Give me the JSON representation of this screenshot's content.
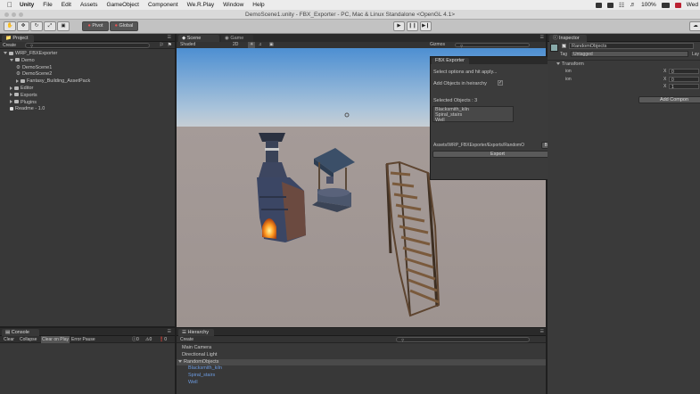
{
  "menubar": {
    "app": "Unity",
    "items": [
      "File",
      "Edit",
      "Assets",
      "GameObject",
      "Component",
      "We.R.Play",
      "Window",
      "Help"
    ],
    "battery": "100%",
    "clock": "Wed"
  },
  "window": {
    "title": "DemoScene1.unity - FBX_Exporter - PC, Mac & Linux Standalone <OpenGL 4.1>"
  },
  "toolbar": {
    "pivot_label": "Pivot",
    "global_label": "Global"
  },
  "project": {
    "tab": "Project",
    "create_label": "Create",
    "tree": [
      {
        "label": "WRP_FBXExporter",
        "depth": 0,
        "kind": "folder",
        "expanded": true
      },
      {
        "label": "Demo",
        "depth": 1,
        "kind": "folder",
        "expanded": true
      },
      {
        "label": "DemoScene1",
        "depth": 2,
        "kind": "scene"
      },
      {
        "label": "DemoScene2",
        "depth": 2,
        "kind": "scene"
      },
      {
        "label": "Fantasy_Building_AssetPack",
        "depth": 2,
        "kind": "folder",
        "expanded": false
      },
      {
        "label": "Editor",
        "depth": 1,
        "kind": "folder",
        "expanded": false
      },
      {
        "label": "Exports",
        "depth": 1,
        "kind": "folder",
        "expanded": false
      },
      {
        "label": "Plugins",
        "depth": 1,
        "kind": "folder",
        "expanded": false
      },
      {
        "label": "Readme - 1.0",
        "depth": 1,
        "kind": "file"
      }
    ]
  },
  "scene": {
    "tab_scene": "Scene",
    "tab_game": "Game",
    "shading": "Shaded",
    "mode_2d": "2D",
    "gizmos": "Gizmos"
  },
  "fbx_exporter": {
    "tab": "FBX Exporter",
    "instruction": "Select options and hit apply...",
    "add_objects_label": "Add Objects in heirarchy",
    "add_objects_checked": true,
    "selected_label": "Selected Objects : 3",
    "selected_objects": [
      "Blacksmith_kiln",
      "Spiral_stairs",
      "Well"
    ],
    "path": "Assets/WRP_FBXExporter/Exports/RandomO",
    "browse_label": "Browse",
    "export_label": "Export"
  },
  "inspector": {
    "tab": "Inspector",
    "object_name": "RandomObjects",
    "tag_label": "Tag",
    "tag_value": "Untagged",
    "layer_label": "Lay",
    "transform_label": "Transform",
    "fields": [
      {
        "label": "ion",
        "axis": "X",
        "value": "0"
      },
      {
        "label": "ion",
        "axis": "X",
        "value": "0"
      },
      {
        "label": "",
        "axis": "X",
        "value": "1"
      }
    ],
    "add_component_label": "Add Compon"
  },
  "console": {
    "tab": "Console",
    "buttons": [
      "Clear",
      "Collapse",
      "Clear on Play",
      "Error Pause"
    ],
    "counts": {
      "info": "0",
      "warn": "0",
      "error": "0"
    }
  },
  "hierarchy": {
    "tab": "Hierarchy",
    "create_label": "Create",
    "items": [
      {
        "label": "Main Camera",
        "depth": 0,
        "selected": false
      },
      {
        "label": "Directional Light",
        "depth": 0,
        "selected": false
      },
      {
        "label": "RandomObjects",
        "depth": 0,
        "selected": true
      },
      {
        "label": "Blacksmith_kiln",
        "depth": 1,
        "selected": false
      },
      {
        "label": "Spiral_stairs",
        "depth": 1,
        "selected": false
      },
      {
        "label": "Well",
        "depth": 1,
        "selected": false
      }
    ]
  },
  "colors": {
    "accent_blue": "#3d6da8",
    "child_text": "#6c9be0",
    "sky_top": "#4d8fd2",
    "ground": "#9f9593"
  }
}
